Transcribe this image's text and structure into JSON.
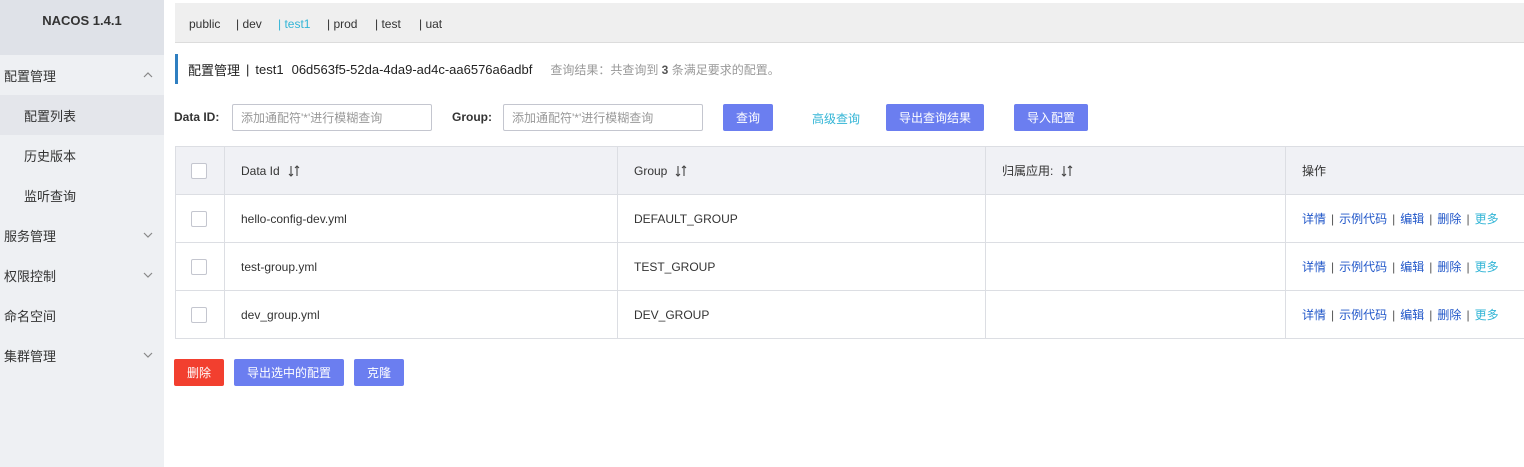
{
  "app": {
    "title": "NACOS 1.4.1"
  },
  "sidebar": {
    "items": [
      {
        "label": "配置管理",
        "level": "top",
        "expanded": true
      },
      {
        "label": "配置列表",
        "level": "sub",
        "selected": true
      },
      {
        "label": "历史版本",
        "level": "sub"
      },
      {
        "label": "监听查询",
        "level": "sub"
      },
      {
        "label": "服务管理",
        "level": "top",
        "expanded": false
      },
      {
        "label": "权限控制",
        "level": "top",
        "expanded": false
      },
      {
        "label": "命名空间",
        "level": "top"
      },
      {
        "label": "集群管理",
        "level": "top",
        "expanded": false
      }
    ]
  },
  "namespaces": {
    "items": [
      "public",
      "| dev",
      "| test1",
      "| prod",
      "| test",
      "| uat"
    ],
    "active": "test1"
  },
  "header": {
    "title": "配置管理",
    "separator": "|",
    "namespace": "test1",
    "namespace_id": "06d563f5-52da-4da9-ad4c-aa6576a6adbf",
    "result_prefix": "查询结果：共查询到",
    "result_count": "3",
    "result_suffix": "条满足要求的配置。"
  },
  "search": {
    "data_id_label": "Data ID:",
    "data_id_placeholder": "添加通配符'*'进行模糊查询",
    "group_label": "Group:",
    "group_placeholder": "添加通配符'*'进行模糊查询",
    "query_button": "查询",
    "advanced_link": "高级查询",
    "export_results_button": "导出查询结果",
    "import_button": "导入配置"
  },
  "table": {
    "columns": [
      "Data Id",
      "Group",
      "归属应用:",
      "操作"
    ],
    "rows": [
      {
        "data_id": "hello-config-dev.yml",
        "group": "DEFAULT_GROUP",
        "app": ""
      },
      {
        "data_id": "test-group.yml",
        "group": "TEST_GROUP",
        "app": ""
      },
      {
        "data_id": "dev_group.yml",
        "group": "DEV_GROUP",
        "app": ""
      }
    ],
    "actions": [
      "详情",
      "示例代码",
      "编辑",
      "删除",
      "更多"
    ],
    "action_separator": "|"
  },
  "footer": {
    "delete_button": "删除",
    "export_selected_button": "导出选中的配置",
    "clone_button": "克隆"
  },
  "colors": {
    "primary_button": "#6b7ef0",
    "danger_button": "#f23f2f",
    "link": "#33b5d6",
    "action_link": "#2157c9",
    "title_accent": "#2f7fc1"
  }
}
